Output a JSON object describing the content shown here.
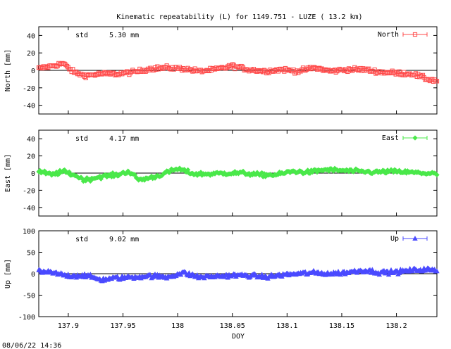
{
  "title": "Kinematic repeatability (L) for 1149.751 - LUZE  ( 13.2 km)",
  "timestamp": "08/06/22 14:36",
  "chart_data": {
    "type": "scatter",
    "xlabel": "DOY",
    "xlim": [
      137.873,
      138.237
    ],
    "xticks": [
      137.9,
      137.95,
      138,
      138.05,
      138.1,
      138.15,
      138.2
    ],
    "xtick_labels": [
      "137.9",
      "137.95",
      "138",
      "138.05",
      "138.1",
      "138.15",
      "138.2"
    ],
    "grid": false,
    "panels": [
      {
        "series_name": "North",
        "legend": "top-right",
        "ylabel": "North [mm]",
        "ylim": [
          -50,
          50
        ],
        "yticks": [
          40,
          20,
          0,
          -20,
          -40
        ],
        "std_label": "std",
        "std_value": "5.30 mm",
        "color": "#ff4a4a",
        "marker": "square",
        "x": [
          137.873,
          137.885,
          137.895,
          137.905,
          137.915,
          137.93,
          137.945,
          137.96,
          137.975,
          137.99,
          138.005,
          138.02,
          138.035,
          138.05,
          138.065,
          138.08,
          138.095,
          138.11,
          138.125,
          138.14,
          138.155,
          138.17,
          138.185,
          138.2,
          138.215,
          138.228,
          138.237
        ],
        "y": [
          2,
          5,
          8,
          -2,
          -6,
          -4,
          -4,
          -2,
          2,
          3,
          2,
          -1,
          1,
          5,
          1,
          -1,
          1,
          -1,
          3,
          -1,
          1,
          1,
          -2,
          -3,
          -4,
          -10,
          -12
        ]
      },
      {
        "series_name": "East",
        "legend": "top-right",
        "ylabel": "East [mm]",
        "ylim": [
          -50,
          50
        ],
        "yticks": [
          40,
          20,
          0,
          -20,
          -40
        ],
        "std_label": "std",
        "std_value": "4.17 mm",
        "color": "#4ae84a",
        "marker": "diamond",
        "x": [
          137.873,
          137.885,
          137.895,
          137.905,
          137.915,
          137.93,
          137.945,
          137.955,
          137.965,
          137.98,
          138.0,
          138.015,
          138.03,
          138.045,
          138.06,
          138.075,
          138.09,
          138.105,
          138.12,
          138.135,
          138.15,
          138.165,
          138.18,
          138.195,
          138.21,
          138.225,
          138.237
        ],
        "y": [
          2,
          -2,
          2,
          -2,
          -8,
          -4,
          -2,
          2,
          -8,
          -4,
          5,
          -1,
          -1,
          0,
          0,
          -2,
          -2,
          2,
          1,
          4,
          3,
          2,
          1,
          2,
          1,
          0,
          -1
        ]
      },
      {
        "series_name": "Up",
        "legend": "top-right",
        "ylabel": "Up [mm]",
        "ylim": [
          -100,
          100
        ],
        "yticks": [
          100,
          50,
          0,
          -50,
          -100
        ],
        "std_label": "std",
        "std_value": "9.02 mm",
        "color": "#4a4aff",
        "marker": "triangle",
        "x": [
          137.873,
          137.885,
          137.9,
          137.915,
          137.93,
          137.945,
          137.96,
          137.975,
          137.99,
          138.005,
          138.02,
          138.035,
          138.05,
          138.065,
          138.08,
          138.095,
          138.11,
          138.125,
          138.14,
          138.155,
          138.17,
          138.185,
          138.2,
          138.215,
          138.228,
          138.237
        ],
        "y": [
          5,
          2,
          -5,
          -4,
          -14,
          -10,
          -8,
          -5,
          -8,
          2,
          -8,
          -6,
          -4,
          -4,
          -8,
          -3,
          0,
          2,
          0,
          3,
          8,
          3,
          4,
          8,
          10,
          6
        ]
      }
    ]
  }
}
